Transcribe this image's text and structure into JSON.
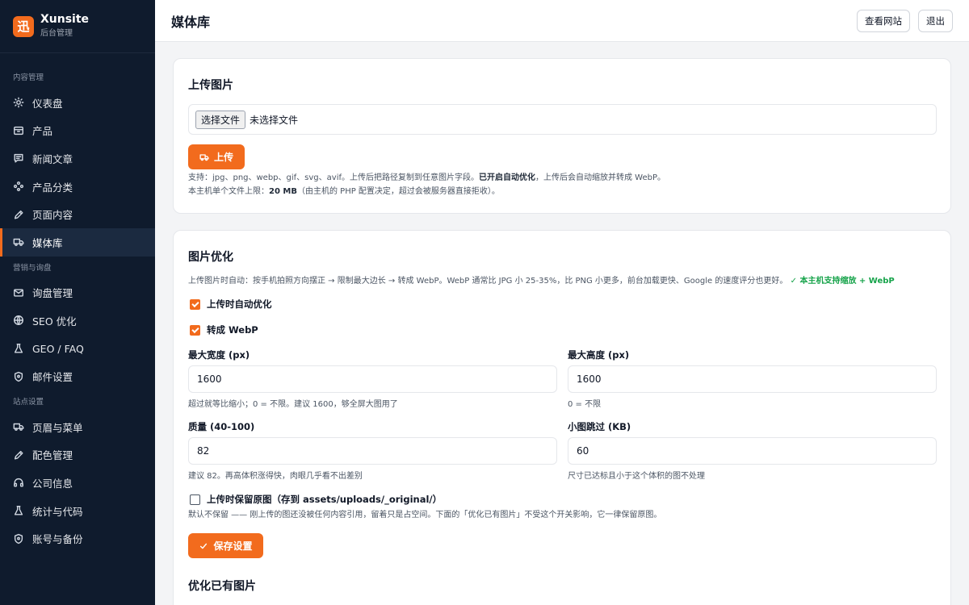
{
  "brand": {
    "logo_char": "迅",
    "name": "Xunsite",
    "subtitle": "后台管理"
  },
  "sidebar": {
    "sections": [
      {
        "title": "内容管理",
        "items": [
          {
            "label": "仪表盘",
            "icon": "sun-icon"
          },
          {
            "label": "产品",
            "icon": "box-icon"
          },
          {
            "label": "新闻文章",
            "icon": "message-icon"
          },
          {
            "label": "产品分类",
            "icon": "grid-dots-icon"
          },
          {
            "label": "页面内容",
            "icon": "pen-icon"
          },
          {
            "label": "媒体库",
            "icon": "truck-icon",
            "active": true
          }
        ]
      },
      {
        "title": "营销与询盘",
        "items": [
          {
            "label": "询盘管理",
            "icon": "mail-icon"
          },
          {
            "label": "SEO 优化",
            "icon": "globe-icon"
          },
          {
            "label": "GEO / FAQ",
            "icon": "flask-icon"
          },
          {
            "label": "邮件设置",
            "icon": "shield-icon"
          }
        ]
      },
      {
        "title": "站点设置",
        "items": [
          {
            "label": "页眉与菜单",
            "icon": "truck-icon"
          },
          {
            "label": "配色管理",
            "icon": "pen-icon"
          },
          {
            "label": "公司信息",
            "icon": "headphones-icon"
          },
          {
            "label": "统计与代码",
            "icon": "flask-icon"
          },
          {
            "label": "账号与备份",
            "icon": "shield-icon"
          }
        ]
      }
    ]
  },
  "header": {
    "title": "媒体库",
    "view_site": "查看网站",
    "logout": "退出"
  },
  "upload": {
    "title": "上传图片",
    "file_button": "选择文件",
    "file_status": "未选择文件",
    "upload_button": "上传",
    "hint1_prefix": "支持：jpg、png、webp、gif、svg、avif。上传后把路径复制到任意图片字段。",
    "hint1_bold": "已开启自动优化",
    "hint1_suffix": "，上传后会自动缩放并转成 WebP。",
    "hint2_prefix": "本主机单个文件上限：",
    "hint2_bold": "20 MB",
    "hint2_suffix": "（由主机的 PHP 配置决定，超过会被服务器直接拒收）。"
  },
  "optimize": {
    "title": "图片优化",
    "desc": "上传图片时自动：按手机拍照方向摆正 → 限制最大边长 → 转成 WebP。WebP 通常比 JPG 小 25-35%，比 PNG 小更多，前台加载更快、Google 的速度评分也更好。",
    "support_note": "✓ 本主机支持缩放 + WebP",
    "auto_optimize": {
      "label": "上传时自动优化",
      "checked": true
    },
    "to_webp": {
      "label": "转成 WebP",
      "checked": true
    },
    "max_width": {
      "label": "最大宽度 (px)",
      "value": "1600",
      "help": "超过就等比缩小；0 = 不限。建议 1600，够全屏大图用了"
    },
    "max_height": {
      "label": "最大高度 (px)",
      "value": "1600",
      "help": "0 = 不限"
    },
    "quality": {
      "label": "质量 (40-100)",
      "value": "82",
      "help": "建议 82。再高体积涨得快，肉眼几乎看不出差别"
    },
    "skip_small": {
      "label": "小图跳过 (KB)",
      "value": "60",
      "help": "尺寸已达标且小于这个体积的图不处理"
    },
    "keep_original": {
      "label": "上传时保留原图（存到 assets/uploads/_original/）",
      "checked": false
    },
    "keep_help": "默认不保留 —— 刚上传的图还没被任何内容引用，留着只是占空间。下面的「优化已有图片」不受这个开关影响，它一律保留原图。",
    "save_button": "保存设置",
    "existing_title": "优化已有图片"
  },
  "colors": {
    "accent": "#f26b1d",
    "sidebar_bg": "#0f1b2d",
    "success": "#16a34a"
  }
}
